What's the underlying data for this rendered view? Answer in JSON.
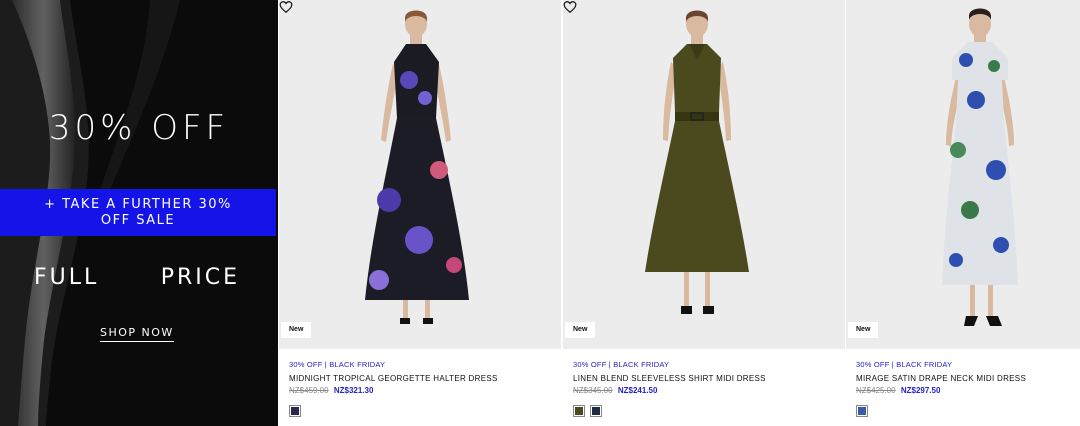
{
  "promo": {
    "headline": "30% OFF",
    "band_text": "+ TAKE A FURTHER 30% OFF SALE",
    "full_word": "FULL",
    "price_word": "PRICE",
    "cta": "SHOP NOW",
    "band_color": "#1414e8"
  },
  "products": [
    {
      "badge": "New",
      "promo_tag": "30% OFF | BLACK FRIDAY",
      "name": "MIDNIGHT TROPICAL GEORGETTE HALTER DRESS",
      "price_old": "NZ$459.00",
      "price_new": "NZ$321.30",
      "wishlist_icon": "heart-outline-icon",
      "swatches": [
        "#2c2550"
      ]
    },
    {
      "badge": "New",
      "promo_tag": "30% OFF | BLACK FRIDAY",
      "name": "LINEN BLEND SLEEVELESS SHIRT MIDI DRESS",
      "price_old": "NZ$345.00",
      "price_new": "NZ$241.50",
      "wishlist_icon": "heart-outline-icon",
      "swatches": [
        "#4a4a1e",
        "#1f2a44"
      ]
    },
    {
      "badge": "New",
      "promo_tag": "30% OFF | BLACK FRIDAY",
      "name": "MIRAGE SATIN DRAPE NECK MIDI DRESS",
      "price_old": "NZ$425.00",
      "price_new": "NZ$297.50",
      "swatches": [
        "#3b5aa6"
      ]
    }
  ],
  "colors": {
    "accent_blue": "#2323c8",
    "image_bg": "#ececec"
  }
}
